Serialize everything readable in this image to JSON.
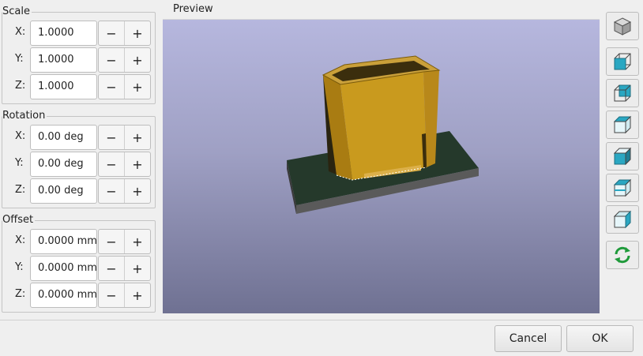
{
  "scale": {
    "title": "Scale",
    "rows": [
      {
        "axis": "X:",
        "value": "1.0000"
      },
      {
        "axis": "Y:",
        "value": "1.0000"
      },
      {
        "axis": "Z:",
        "value": "1.0000"
      }
    ]
  },
  "rotation": {
    "title": "Rotation",
    "rows": [
      {
        "axis": "X:",
        "value": "0.00 deg"
      },
      {
        "axis": "Y:",
        "value": "0.00 deg"
      },
      {
        "axis": "Z:",
        "value": "0.00 deg"
      }
    ]
  },
  "offset": {
    "title": "Offset",
    "rows": [
      {
        "axis": "X:",
        "value": "0.0000 mm"
      },
      {
        "axis": "Y:",
        "value": "0.0000 mm"
      },
      {
        "axis": "Z:",
        "value": "0.0000 mm"
      }
    ]
  },
  "stepper": {
    "minus": "−",
    "plus": "+"
  },
  "preview": {
    "title": "Preview"
  },
  "view_buttons": [
    "iso-view-icon",
    "front-view-icon",
    "back-view-icon",
    "top-view-icon",
    "bottom-view-icon",
    "left-view-icon",
    "right-view-icon",
    "reload-icon"
  ],
  "buttons": {
    "cancel": "Cancel",
    "ok": "OK"
  },
  "colors": {
    "model": "#c99a1e",
    "base": "#25392b",
    "accent": "#2aa7c2"
  }
}
